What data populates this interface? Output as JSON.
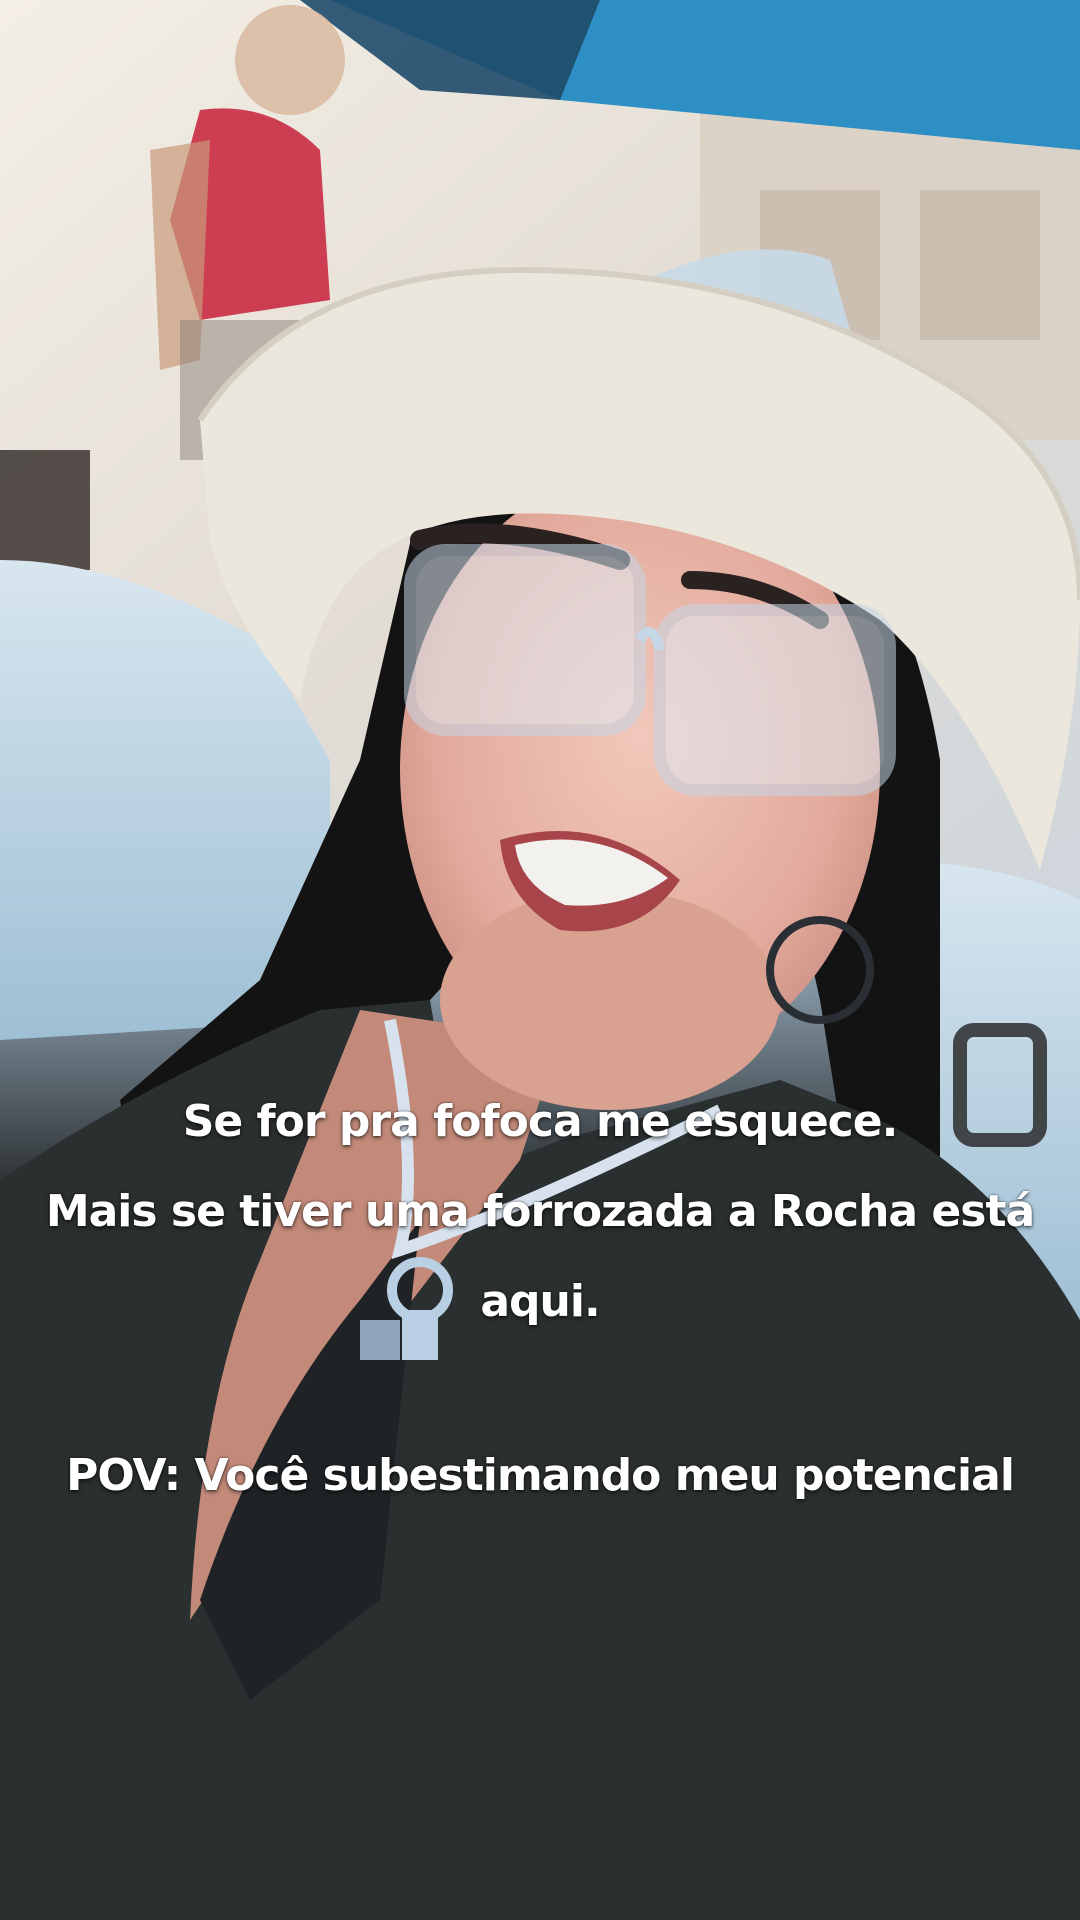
{
  "overlay_text": {
    "line1": "Se for pra fofoca me esquece.",
    "line2": "Mais se tiver uma forrozada a Rocha está",
    "line3": "aqui.",
    "line4": "POV: Você subestimando meu potencial"
  },
  "colors": {
    "caption_text": "#ffffff",
    "hat": "#ece7dc",
    "shirt": "#2a2f30",
    "awning": "#2d8fc4"
  }
}
